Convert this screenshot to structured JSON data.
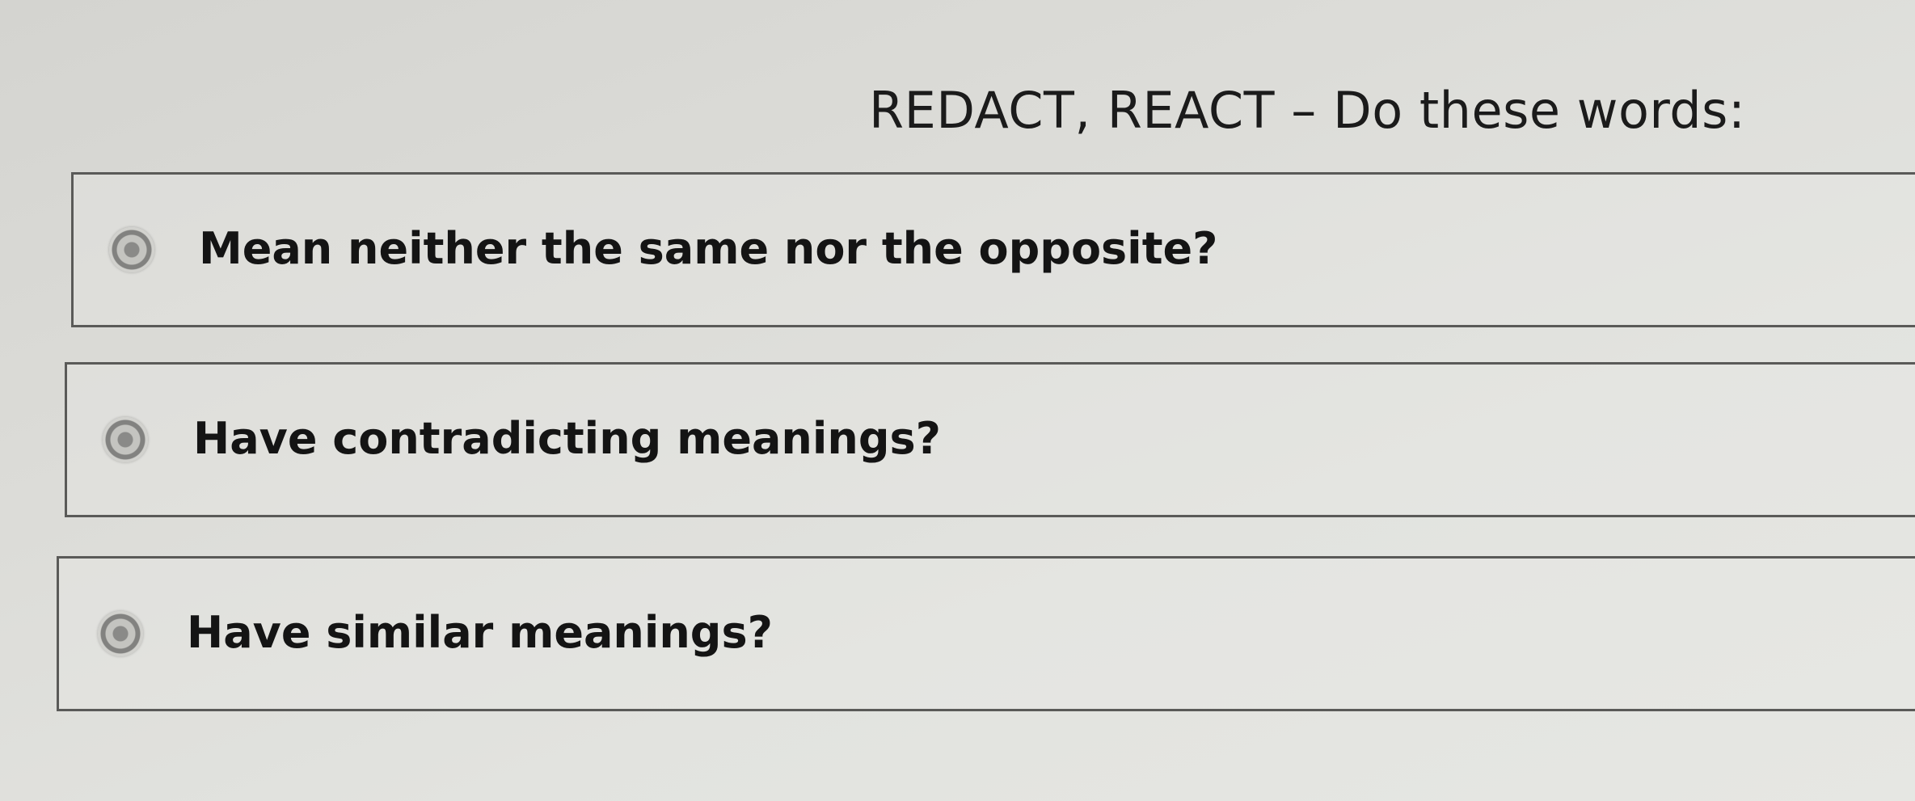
{
  "question": {
    "text": "REDACT, REACT – Do these words:"
  },
  "options": [
    {
      "label": "Mean neither the same nor the opposite?",
      "selected": false
    },
    {
      "label": "Have contradicting meanings?",
      "selected": false
    },
    {
      "label": "Have similar meanings?",
      "selected": false
    }
  ]
}
